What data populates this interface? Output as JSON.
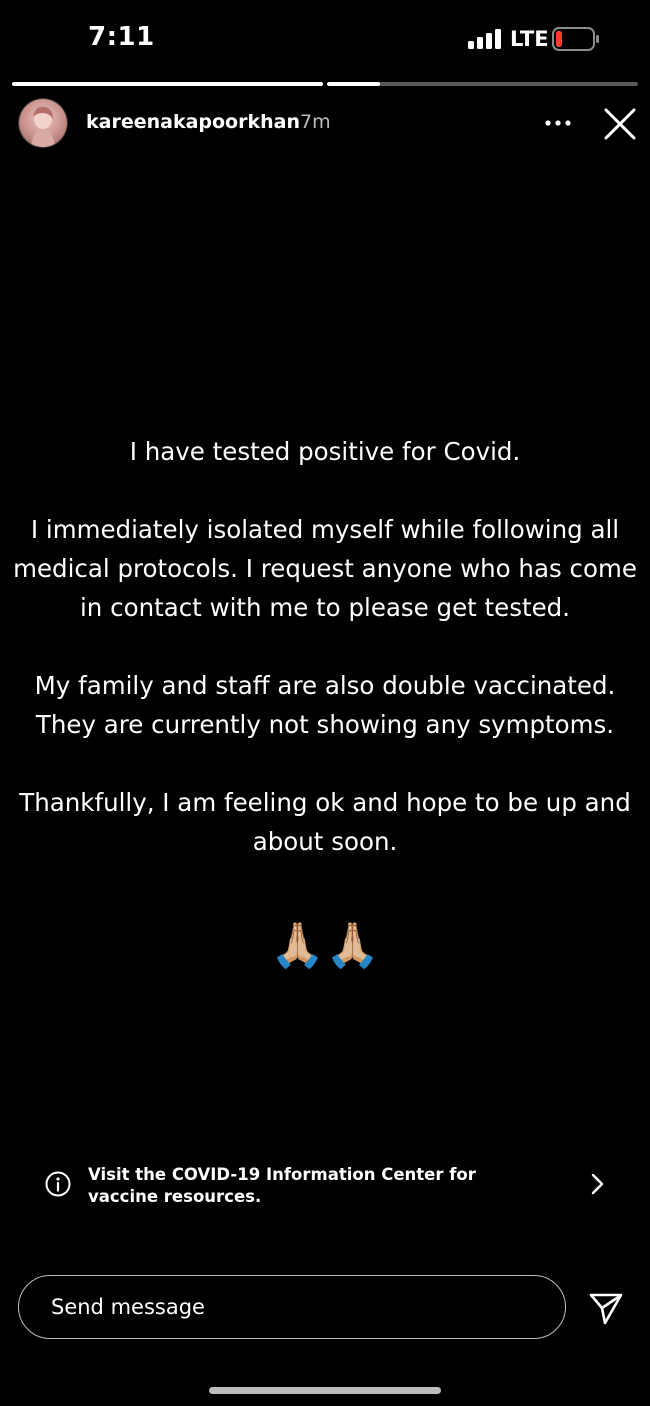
{
  "status_bar": {
    "time": "7:11",
    "network": "LTE",
    "signal_icon": "cellular-signal-icon",
    "battery_icon": "battery-low-icon",
    "battery_color": "#ff3b30"
  },
  "story": {
    "progress": [
      1.0,
      0.17
    ],
    "username": "kareenakapoorkhan",
    "time_ago": "7m",
    "more_icon": "more-options-icon",
    "close_icon": "close-icon",
    "paragraphs": [
      "I have tested positive for Covid.",
      "I immediately isolated myself while following all medical protocols. I request anyone who has come in contact with me to please get tested.",
      "My family and staff are also double vaccinated. They are currently not showing any symptoms.",
      "Thankfully, I am feeling ok and hope to be up and about soon."
    ],
    "emoji": "🙏🏼🙏🏼"
  },
  "info_banner": {
    "line1": "Visit the COVID-19 Information Center for",
    "line2": "vaccine resources.",
    "icon": "info-icon",
    "chevron": "chevron-right-icon"
  },
  "message_bar": {
    "placeholder": "Send message",
    "send_icon": "send-icon"
  }
}
